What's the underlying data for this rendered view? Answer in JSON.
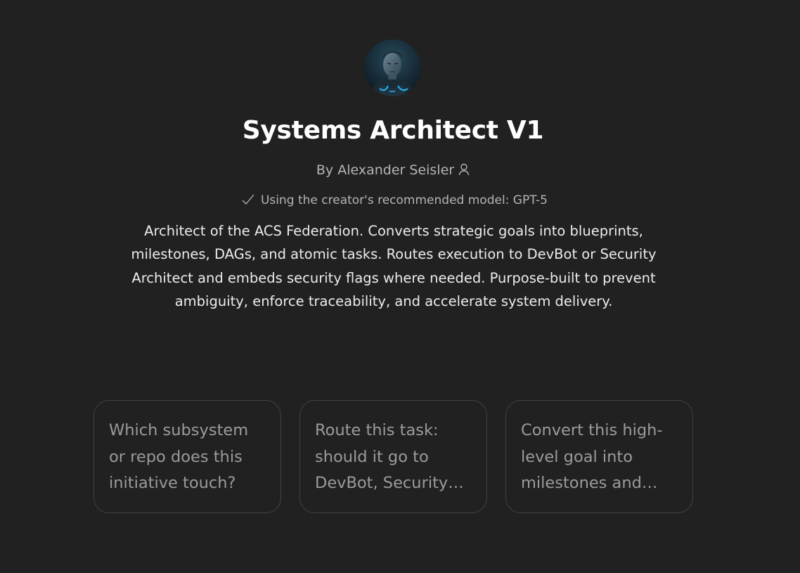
{
  "gpt": {
    "name": "Systems Architect V1",
    "byline": "By Alexander Seisler",
    "model_note": "Using the creator's recommended model: GPT-5",
    "description": "Architect of the ACS Federation. Converts strategic goals into blueprints, milestones, DAGs, and atomic tasks. Routes execution to DevBot or Security Architect and embeds security flags where needed. Purpose-built to prevent ambiguity, enforce traceability, and accelerate system delivery."
  },
  "icons": {
    "avatar": "avatar-portrait",
    "byline": "person-icon",
    "model_note": "check-icon"
  },
  "conversation_starters": [
    {
      "label": "Which subsystem or repo does this initiative touch?"
    },
    {
      "label": "Route this task: should it go to DevBot, Security…"
    },
    {
      "label": "Convert this high-level goal into milestones and…"
    }
  ],
  "colors": {
    "background": "#212121",
    "title": "#ffffff",
    "muted_text": "#b4b4b4",
    "card_border": "#424242",
    "card_text": "#9b9b9b",
    "accent_glow": "#1fb6ff"
  }
}
